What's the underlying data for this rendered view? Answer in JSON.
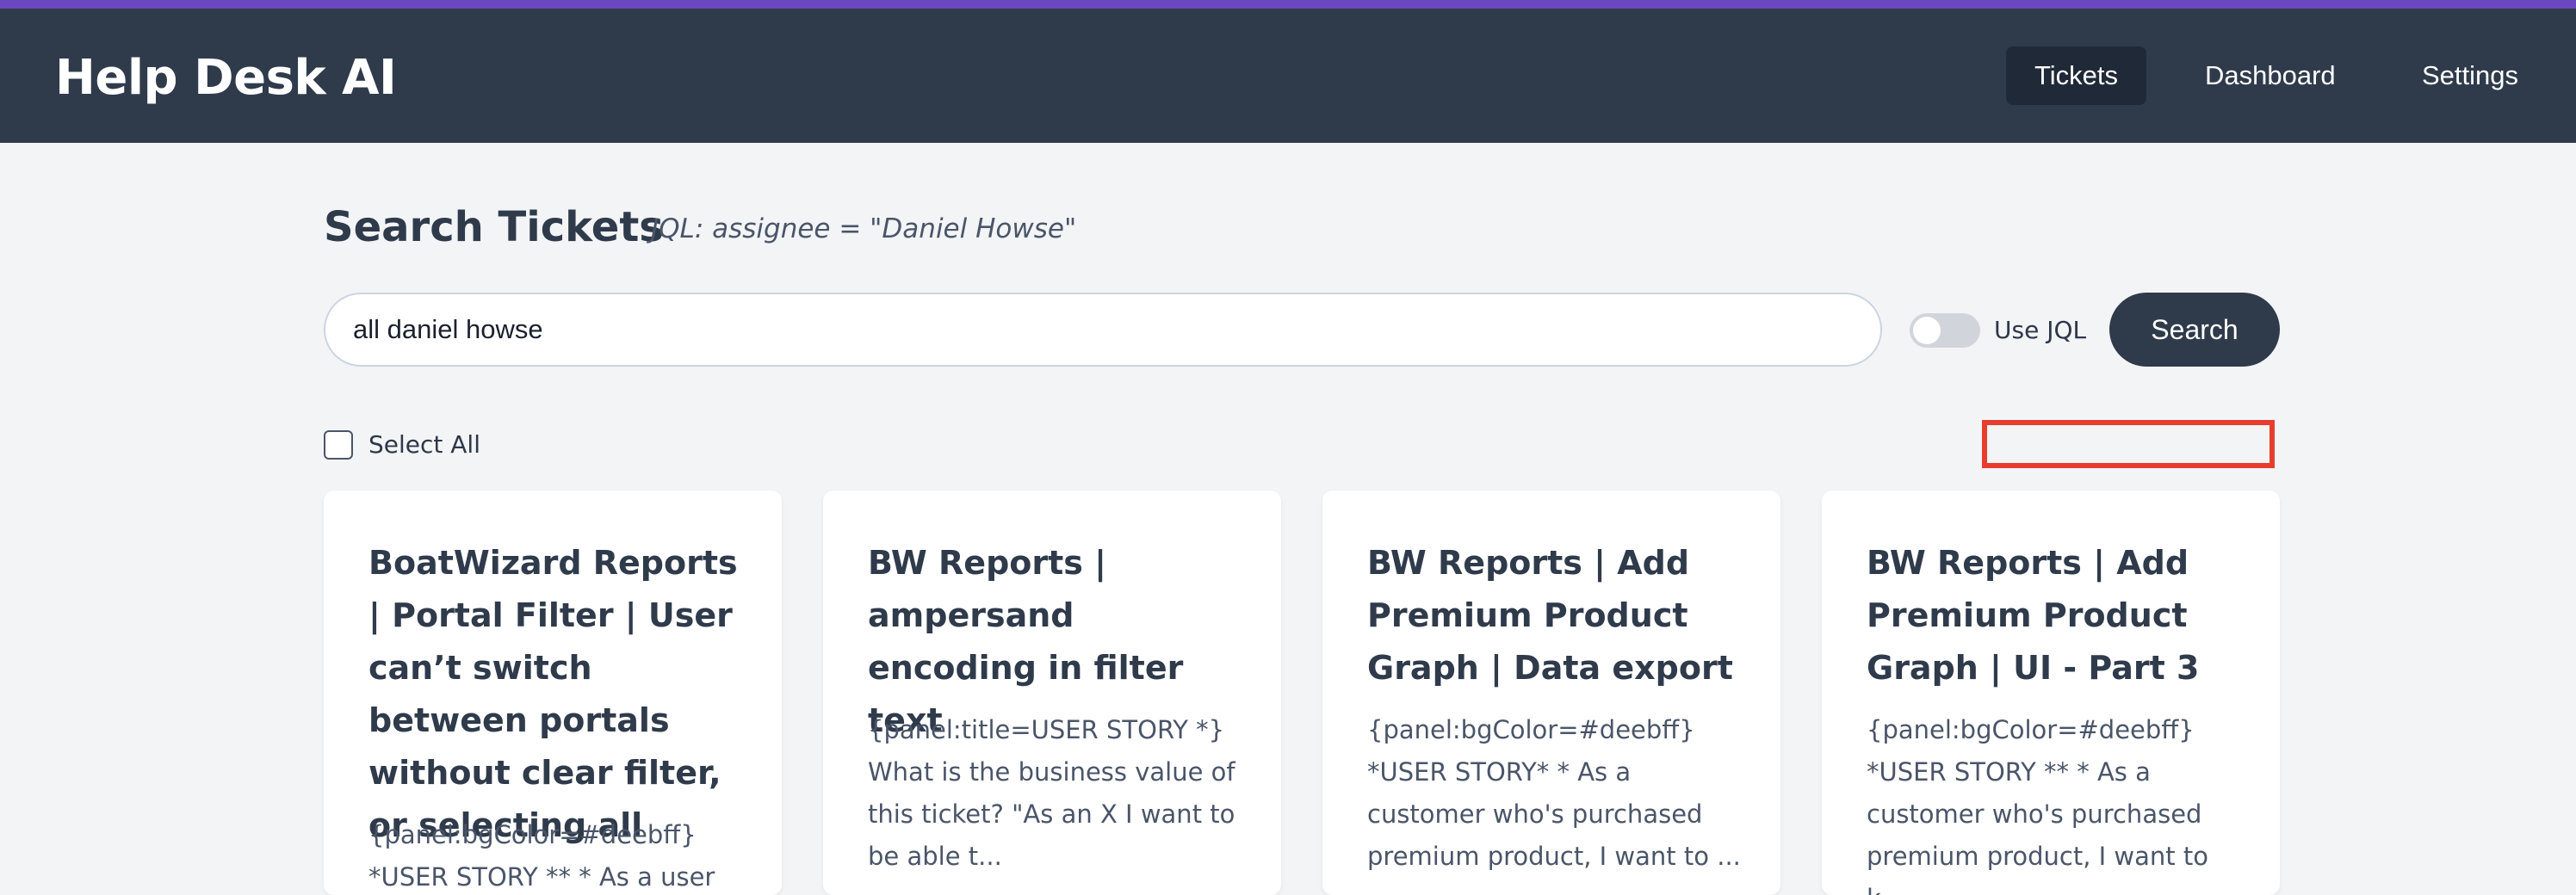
{
  "app": {
    "title": "Help Desk AI",
    "nav": [
      {
        "label": "Tickets",
        "active": true
      },
      {
        "label": "Dashboard",
        "active": false
      },
      {
        "label": "Settings",
        "active": false
      }
    ]
  },
  "search": {
    "heading": "Search Tickets",
    "jql_hint": "JQL: assignee = \"Daniel Howse\"",
    "query": "all daniel howse",
    "toggle_label": "Use JQL",
    "toggle_on": false,
    "button_label": "Search"
  },
  "select_all": {
    "label": "Select All",
    "checked": false
  },
  "tickets": [
    {
      "title": "BoatWizard Reports | Portal Filter | User can’t switch between portals without clear filter, or selecting all",
      "description": "{panel:bgColor=#deebff} *USER STORY ** * As a user"
    },
    {
      "title": "BW Reports | ampersand encoding in filter text",
      "description": "{panel:title=USER STORY *} What is the business value of this ticket? \"As an X I want to be able t..."
    },
    {
      "title": "BW Reports | Add Premium Product Graph | Data export",
      "description": "{panel:bgColor=#deebff} *USER STORY* * As a customer who's purchased premium product, I want to ..."
    },
    {
      "title": "BW Reports | Add Premium Product Graph | UI - Part 3",
      "description": "{panel:bgColor=#deebff} *USER STORY ** * As a customer who's purchased premium product, I want to k..."
    }
  ],
  "colors": {
    "header_bg": "#2f3b4b",
    "accent_strip": "#6b46c1",
    "highlight_box": "#e53e2f",
    "page_bg": "#f3f4f6"
  }
}
